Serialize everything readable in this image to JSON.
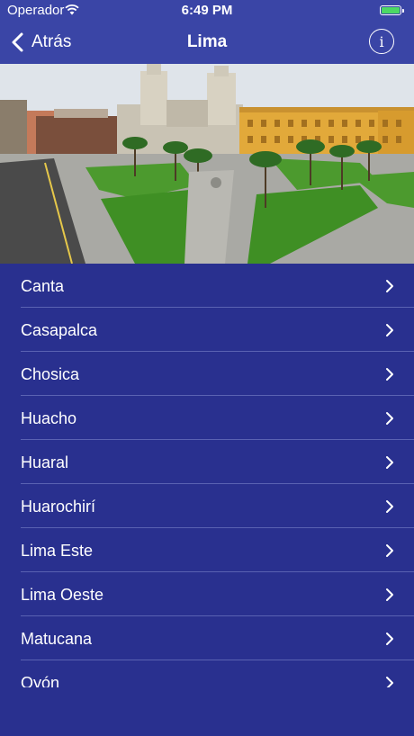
{
  "status": {
    "carrier": "Operador",
    "time": "6:49 PM",
    "battery_level": 1.0
  },
  "nav": {
    "back_label": "Atrás",
    "title": "Lima",
    "info_label": "i"
  },
  "colors": {
    "background": "#29308f",
    "bar": "#3a45a6",
    "separator": "#5a62b2",
    "battery": "#4cd964"
  },
  "list": {
    "items": [
      {
        "label": "Canta"
      },
      {
        "label": "Casapalca"
      },
      {
        "label": "Chosica"
      },
      {
        "label": "Huacho"
      },
      {
        "label": "Huaral"
      },
      {
        "label": "Huarochirí"
      },
      {
        "label": "Lima Este"
      },
      {
        "label": "Lima Oeste"
      },
      {
        "label": "Matucana"
      },
      {
        "label": "Oyón"
      }
    ]
  }
}
